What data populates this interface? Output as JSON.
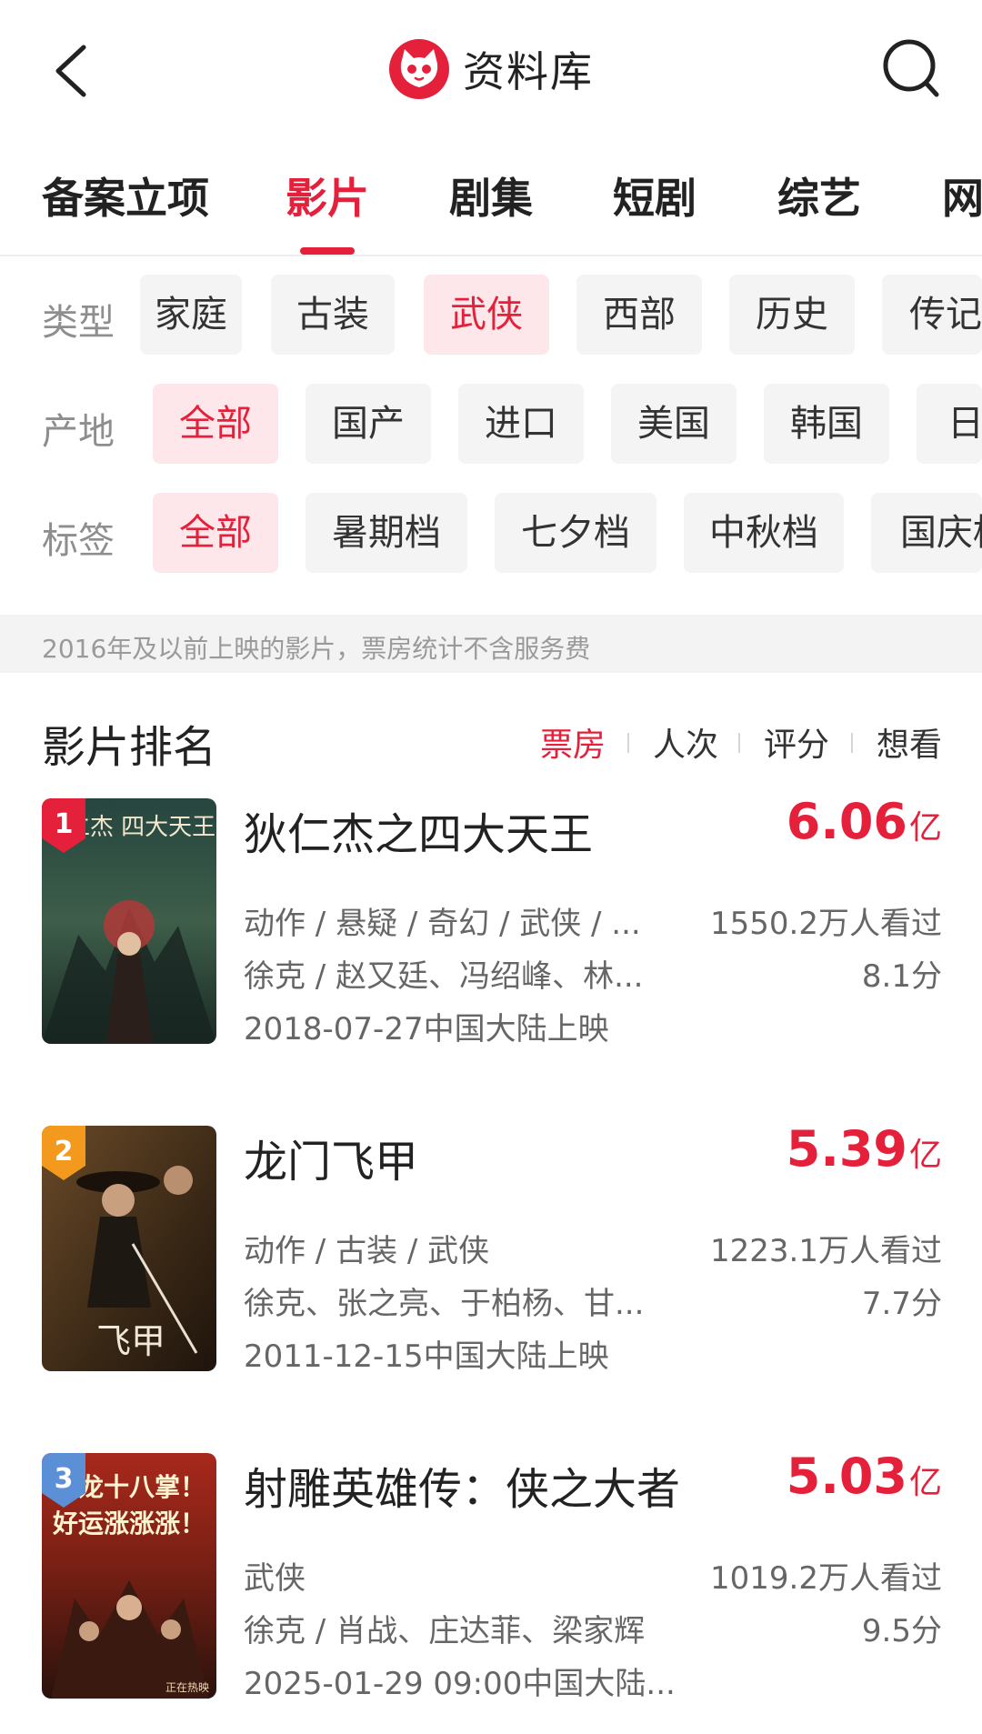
{
  "header": {
    "title": "资料库",
    "back_icon": "back-arrow-icon",
    "search_icon": "search-icon",
    "brand_color": "#e5203a"
  },
  "tabs": [
    {
      "label": "备案立项"
    },
    {
      "label": "影片",
      "active": true
    },
    {
      "label": "剧集"
    },
    {
      "label": "短剧"
    },
    {
      "label": "综艺"
    },
    {
      "label": "网"
    }
  ],
  "filters": {
    "type": {
      "label": "类型",
      "chips": [
        "家庭",
        "古装",
        "武侠",
        "西部",
        "历史",
        "传记"
      ],
      "selected": "武侠"
    },
    "region": {
      "label": "产地",
      "chips": [
        "全部",
        "国产",
        "进口",
        "美国",
        "韩国",
        "日"
      ],
      "selected": "全部"
    },
    "tag": {
      "label": "标签",
      "chips": [
        "全部",
        "暑期档",
        "七夕档",
        "中秋档",
        "国庆档"
      ],
      "selected": "全部"
    }
  },
  "notice": "2016年及以前上映的影片，票房统计不含服务费",
  "ranking": {
    "title": "影片排名",
    "sort_options": [
      "票房",
      "人次",
      "评分",
      "想看"
    ],
    "active_sort": "票房"
  },
  "films": [
    {
      "rank": "1",
      "title": "狄仁杰之四大天王",
      "box_office": "6.06",
      "unit": "亿",
      "genres": "动作 / 悬疑 / 奇幻 / 武侠 / ...",
      "viewers": "1550.2万人看过",
      "cast": "徐克 / 赵又廷、冯绍峰、林...",
      "score": "8.1分",
      "release": "2018-07-27中国大陆上映",
      "poster_text": "狄仁杰 四大天王",
      "badge_color": "#e5203a"
    },
    {
      "rank": "2",
      "title": "龙门飞甲",
      "box_office": "5.39",
      "unit": "亿",
      "genres": "动作 / 古装 / 武侠",
      "viewers": "1223.1万人看过",
      "cast": "徐克、张之亮、于柏杨、甘...",
      "score": "7.7分",
      "release": "2011-12-15中国大陆上映",
      "poster_text": "飞甲",
      "badge_color": "#f39a1e"
    },
    {
      "rank": "3",
      "title": "射雕英雄传：侠之大者",
      "box_office": "5.03",
      "unit": "亿",
      "genres": "武侠",
      "viewers": "1019.2万人看过",
      "cast": "徐克 / 肖战、庄达菲、梁家辉",
      "score": "9.5分",
      "release": "2025-01-29 09:00中国大陆...",
      "poster_text": "降龙十八掌！好运涨涨涨！",
      "poster_footer": "正在热映",
      "badge_color": "#5b8fd6"
    }
  ]
}
